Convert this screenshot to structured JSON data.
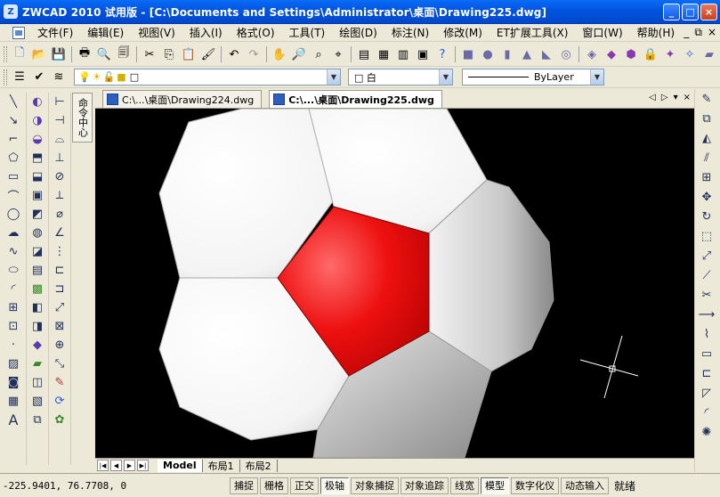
{
  "window": {
    "app_mark": "Z",
    "title": "ZWCAD 2010 试用版 - [C:\\Documents and Settings\\Administrator\\桌面\\Drawing225.dwg]",
    "controls": [
      "_",
      "□",
      "×"
    ]
  },
  "menu": {
    "items": [
      "文件(F)",
      "编辑(E)",
      "视图(V)",
      "插入(I)",
      "格式(O)",
      "工具(T)",
      "绘图(D)",
      "标注(N)",
      "修改(M)",
      "ET扩展工具(X)",
      "窗口(W)",
      "帮助(H)"
    ],
    "doc_controls": [
      "_",
      "⧉",
      "×"
    ]
  },
  "layer_bar": {
    "layer_value": "□",
    "color_value": "□ 白",
    "linetype_value": "ByLayer"
  },
  "tabs": [
    {
      "label": "C:\\...\\桌面\\Drawing224.dwg",
      "active": false
    },
    {
      "label": "C:\\...\\桌面\\Drawing225.dwg",
      "active": true
    }
  ],
  "tab_controls": [
    "◁",
    "▷",
    "▾",
    "×"
  ],
  "vertical_panel_label": "命令中心",
  "layout_tabs": [
    "Model",
    "布局1",
    "布局2"
  ],
  "status": {
    "coordinates": "-225.9401,  76.7708,  0",
    "buttons": [
      {
        "label": "捕捉",
        "on": false
      },
      {
        "label": "栅格",
        "on": false
      },
      {
        "label": "正交",
        "on": false
      },
      {
        "label": "极轴",
        "on": true
      },
      {
        "label": "对象捕捉",
        "on": false
      },
      {
        "label": "对象追踪",
        "on": false
      },
      {
        "label": "线宽",
        "on": false
      },
      {
        "label": "模型",
        "on": true
      },
      {
        "label": "数字化仪",
        "on": false
      },
      {
        "label": "动态输入",
        "on": false
      }
    ],
    "ready_text": "就绪"
  },
  "colors": {
    "title_bar": "#0254e0",
    "canvas_bg": "#000000",
    "highlight_pentagon": "#e00000",
    "panel_white": "#ffffff"
  }
}
